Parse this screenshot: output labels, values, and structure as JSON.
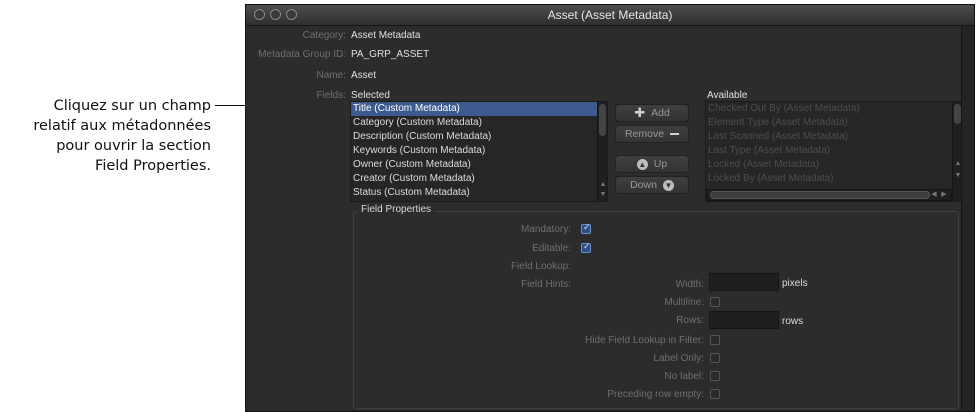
{
  "callout": {
    "line1": "Cliquez sur un champ",
    "line2": "relatif aux métadonnées",
    "line3": "pour ouvrir la section",
    "line4": "Field Properties."
  },
  "window": {
    "title": "Asset (Asset Metadata)"
  },
  "form": {
    "category_label": "Category:",
    "category_value": "Asset Metadata",
    "group_id_label": "Metadata Group ID:",
    "group_id_value": "PA_GRP_ASSET",
    "name_label": "Name:",
    "name_value": "Asset",
    "fields_label": "Fields:"
  },
  "selected": {
    "header": "Selected",
    "items": [
      "Title (Custom Metadata)",
      "Category (Custom Metadata)",
      "Description (Custom Metadata)",
      "Keywords (Custom Metadata)",
      "Owner (Custom Metadata)",
      "Creator (Custom Metadata)",
      "Status (Custom Metadata)"
    ],
    "selected_index": 0
  },
  "available": {
    "header": "Available",
    "items": [
      "Checked Out By (Asset Metadata)",
      "Element Type (Asset Metadata)",
      "Last Scanned (Asset Metadata)",
      "Last Type (Asset Metadata)",
      "Locked (Asset Metadata)",
      "Locked By (Asset Metadata)"
    ]
  },
  "buttons": {
    "add": "Add",
    "remove": "Remove",
    "up": "Up",
    "down": "Down"
  },
  "field_properties": {
    "title": "Field Properties",
    "mandatory_label": "Mandatory:",
    "mandatory_checked": true,
    "editable_label": "Editable:",
    "editable_checked": true,
    "field_lookup_label": "Field Lookup:",
    "field_hints_label": "Field Hints:",
    "width_label": "Width:",
    "width_unit": "pixels",
    "multiline_label": "Multiline:",
    "rows_label": "Rows:",
    "rows_unit": "rows",
    "hide_lookup_label": "Hide Field Lookup in Filter:",
    "label_only_label": "Label Only:",
    "no_label_label": "No label:",
    "preceding_row_label": "Preceding row empty:"
  },
  "colors": {
    "window_bg": "#2c2c2c",
    "selection": "#3d5a8e",
    "checkbox_on": "#2e4f86"
  }
}
